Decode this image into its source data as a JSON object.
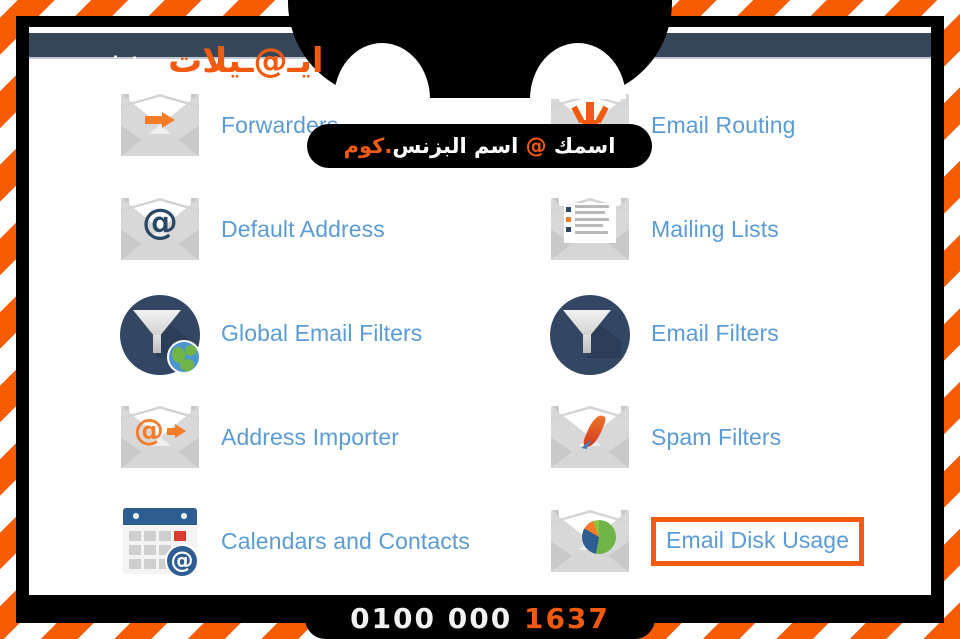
{
  "branding": {
    "logo_orange": "ايـ@ـيلات",
    "logo_white": ".بزنس",
    "tagline_part1": "اسمك ",
    "tagline_at": "@",
    "tagline_part2": " اسم البزنس",
    "tagline_dot": ".",
    "tagline_com": "كوم",
    "phone_white": "0100 000",
    "phone_orange": "1637",
    "accent_orange": "#f15a0f",
    "navy": "#37475a",
    "link_blue": "#5b9bd5"
  },
  "panel": {
    "items": [
      {
        "label": "Forwarders",
        "icon": "envelope-forward-icon",
        "highlighted": false
      },
      {
        "label": "Email Routing",
        "icon": "envelope-download-icon",
        "highlighted": false
      },
      {
        "label": "Default Address",
        "icon": "envelope-at-icon",
        "highlighted": false
      },
      {
        "label": "Mailing Lists",
        "icon": "envelope-list-icon",
        "highlighted": false
      },
      {
        "label": "Global Email Filters",
        "icon": "funnel-globe-icon",
        "highlighted": false
      },
      {
        "label": "Email Filters",
        "icon": "funnel-icon",
        "highlighted": false
      },
      {
        "label": "Address Importer",
        "icon": "envelope-at-arrow-icon",
        "highlighted": false
      },
      {
        "label": "Spam Filters",
        "icon": "envelope-feather-icon",
        "highlighted": false
      },
      {
        "label": "Calendars and Contacts",
        "icon": "calendar-at-icon",
        "highlighted": false
      },
      {
        "label": "Email Disk Usage",
        "icon": "envelope-pie-icon",
        "highlighted": true
      }
    ]
  }
}
